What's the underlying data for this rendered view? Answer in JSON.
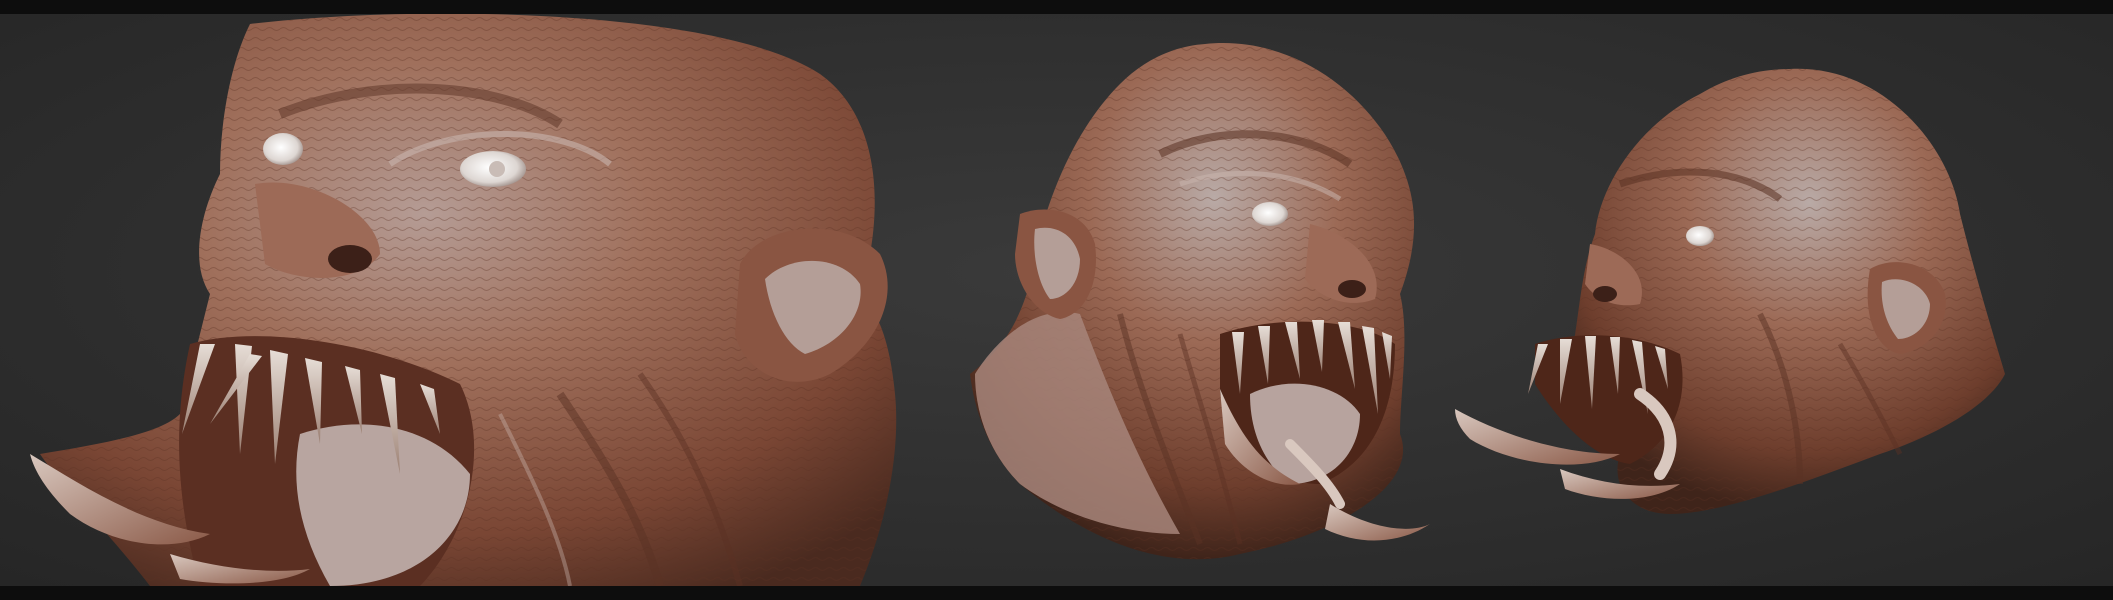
{
  "scene": {
    "description_icon_names": [
      "creature-head-left-closeup",
      "creature-head-center-threequarter",
      "creature-head-right-profile"
    ],
    "colors": {
      "background": "#2f2f2f",
      "letterbox": "#0d0d0d",
      "skin_base": "#8e5a45",
      "skin_highlight": "#b9a8a4",
      "skin_shadow": "#4a2a1f",
      "tooth": "#d8cfc8",
      "eye": "#e8e4e0"
    }
  }
}
